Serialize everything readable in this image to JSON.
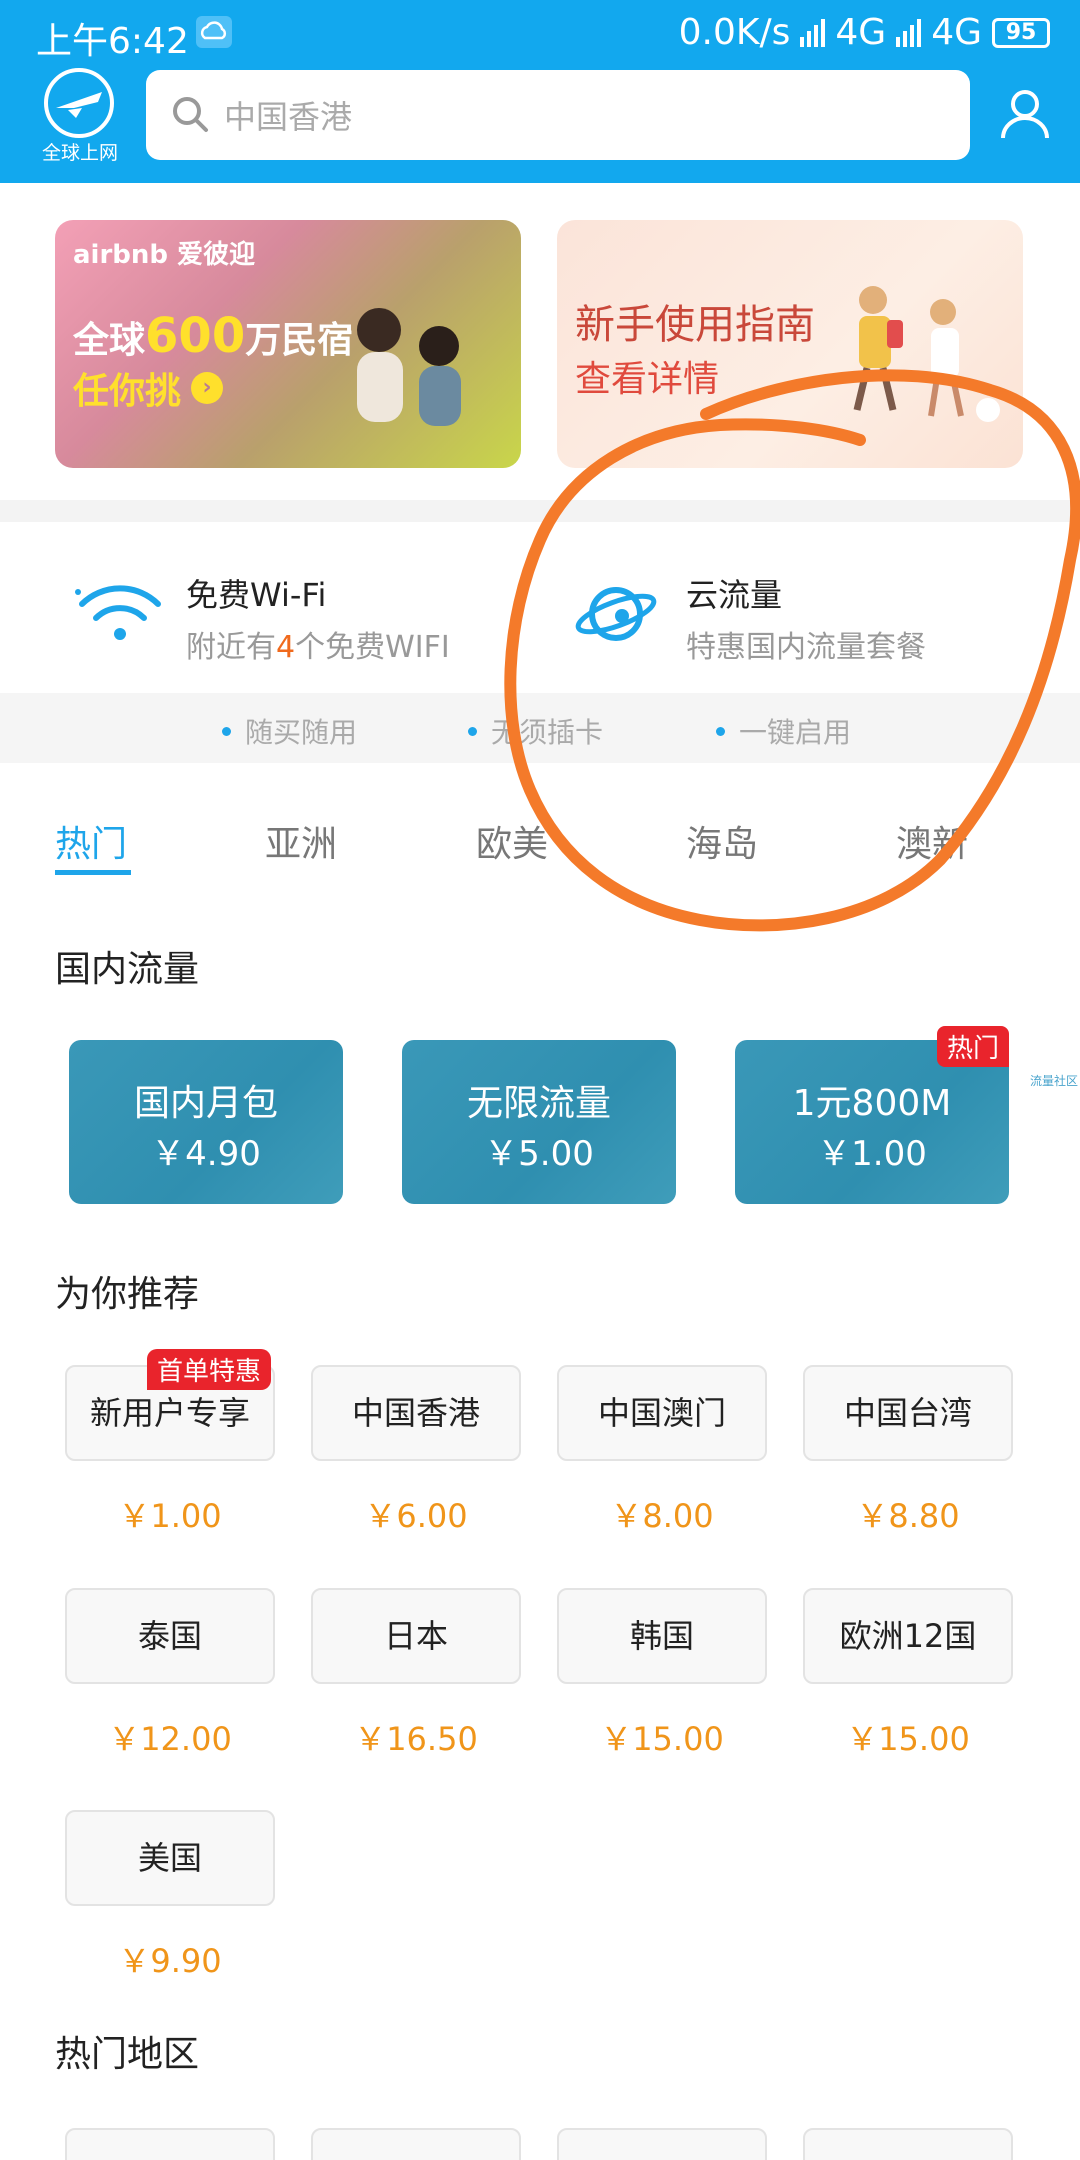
{
  "status_bar": {
    "time": "上午6:42",
    "network_speed": "0.0K/s",
    "net1": "4G",
    "net2": "4G",
    "battery": "95"
  },
  "header": {
    "logo_label": "全球上网",
    "search_placeholder": "中国香港"
  },
  "banners": {
    "airbnb": {
      "brand": "airbnb 爱彼迎",
      "line1_prefix": "全球",
      "line1_big": "600",
      "line1_suffix": "万民宿",
      "line2": "任你挑"
    },
    "guide": {
      "title": "新手使用指南",
      "subtitle": "查看详情"
    }
  },
  "services": {
    "wifi": {
      "title": "免费Wi-Fi",
      "sub_prefix": "附近有",
      "sub_count": "4",
      "sub_suffix": "个免费WIFI"
    },
    "cloud": {
      "title": "云流量",
      "subtitle": "特惠国内流量套餐"
    },
    "features": [
      "随买随用",
      "无须插卡",
      "一键启用"
    ]
  },
  "tabs": [
    "热门",
    "亚洲",
    "欧美",
    "海岛",
    "澳新"
  ],
  "domestic": {
    "title": "国内流量",
    "plans": [
      {
        "name": "国内月包",
        "price": "￥4.90"
      },
      {
        "name": "无限流量",
        "price": "￥5.00"
      },
      {
        "name": "1元800M",
        "price": "￥1.00",
        "badge": "热门"
      }
    ],
    "side_note": "流量社区"
  },
  "recommend": {
    "title": "为你推荐",
    "badge": "首单特惠",
    "items": [
      {
        "name": "新用户专享",
        "price": "￥1.00"
      },
      {
        "name": "中国香港",
        "price": "￥6.00"
      },
      {
        "name": "中国澳门",
        "price": "￥8.00"
      },
      {
        "name": "中国台湾",
        "price": "￥8.80"
      },
      {
        "name": "泰国",
        "price": "￥12.00"
      },
      {
        "name": "日本",
        "price": "￥16.50"
      },
      {
        "name": "韩国",
        "price": "￥15.00"
      },
      {
        "name": "欧洲12国",
        "price": "￥15.00"
      },
      {
        "name": "美国",
        "price": "￥9.90"
      }
    ]
  },
  "hot_regions": {
    "title": "热门地区"
  },
  "colors": {
    "header_blue": "#12a8ee",
    "accent_blue": "#1ea5ea",
    "price_orange": "#f0951a",
    "badge_red": "#e9242c",
    "annotation_orange": "#f47a2a"
  }
}
